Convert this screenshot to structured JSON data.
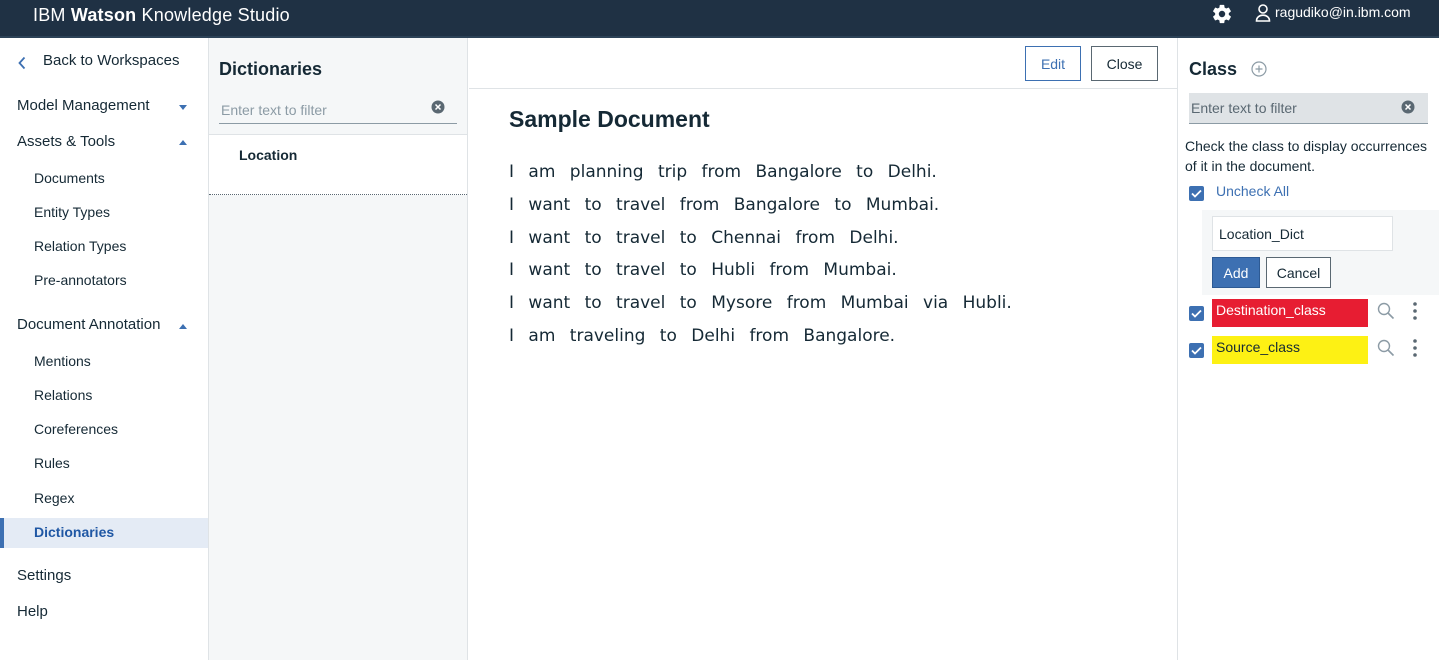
{
  "header": {
    "brand_prefix": "IBM",
    "brand_bold": "Watson",
    "brand_suffix": "Knowledge Studio",
    "settings_icon": "gear-icon",
    "user_icon": "user-icon",
    "user_email": "ragudiko@in.ibm.com"
  },
  "leftnav": {
    "back_label": "Back to Workspaces",
    "model_management": "Model Management",
    "assets_tools": "Assets & Tools",
    "assets_items": [
      "Documents",
      "Entity Types",
      "Relation Types",
      "Pre-annotators"
    ],
    "document_annotation": "Document Annotation",
    "annotation_items": [
      "Mentions",
      "Relations",
      "Coreferences",
      "Rules",
      "Regex",
      "Dictionaries"
    ],
    "active_item": "Dictionaries",
    "settings": "Settings",
    "help": "Help"
  },
  "dictionaries": {
    "title": "Dictionaries",
    "filter_placeholder": "Enter text to filter",
    "items": [
      "Location"
    ]
  },
  "document": {
    "edit_label": "Edit",
    "close_label": "Close",
    "title": "Sample Document",
    "lines": [
      "I am planning trip from Bangalore to Delhi.",
      "I want to travel from Bangalore to Mumbai.",
      "I want to travel to Chennai from Delhi.",
      "I want to travel to Hubli from Mumbai.",
      "I want to travel to Mysore from Mumbai via Hubli.",
      "I am traveling to Delhi from Bangalore."
    ]
  },
  "class_panel": {
    "title": "Class",
    "filter_placeholder": "Enter text to filter",
    "help_text": "Check the class to display occurrences of it in the document.",
    "uncheck_all": "Uncheck All",
    "new_class_value": "Location_Dict",
    "add_label": "Add",
    "cancel_label": "Cancel",
    "classes": [
      {
        "name": "Destination_class",
        "color": "#e71d32",
        "checked": true
      },
      {
        "name": "Source_class",
        "color": "#fdf114",
        "checked": true
      }
    ]
  },
  "colors": {
    "topbar": "#1f3144",
    "accent": "#3d70b2",
    "active_bg": "#e4ebf5"
  }
}
